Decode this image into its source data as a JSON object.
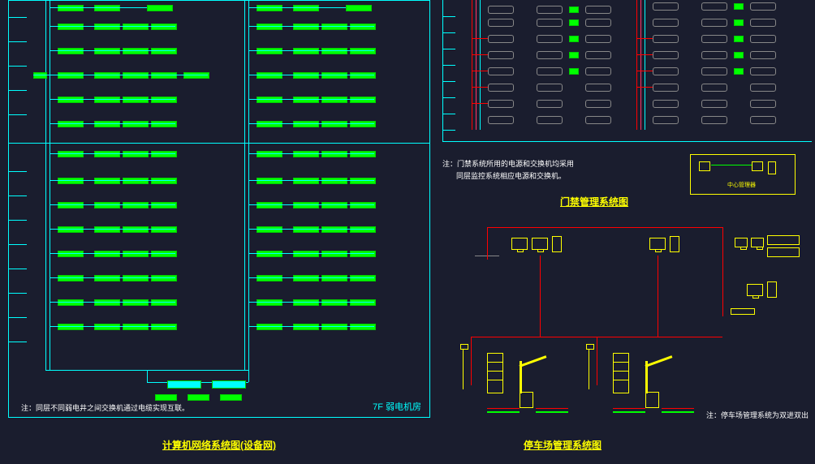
{
  "titles": {
    "network": "计算机网络系统图(设备网)",
    "access": "门禁管理系统图",
    "parking": "停车场管理系统图"
  },
  "room_label": "7F 弱电机房",
  "notes": {
    "network": "注：同层不同弱电井之间交换机通过电缆实现互联。",
    "access_line1": "注：门禁系统所用的电源和交换机均采用",
    "access_line2": "同层监控系统相应电源和交换机。",
    "parking": "注：停车场管理系统为双进双出"
  },
  "legend_label": "中心管理器"
}
